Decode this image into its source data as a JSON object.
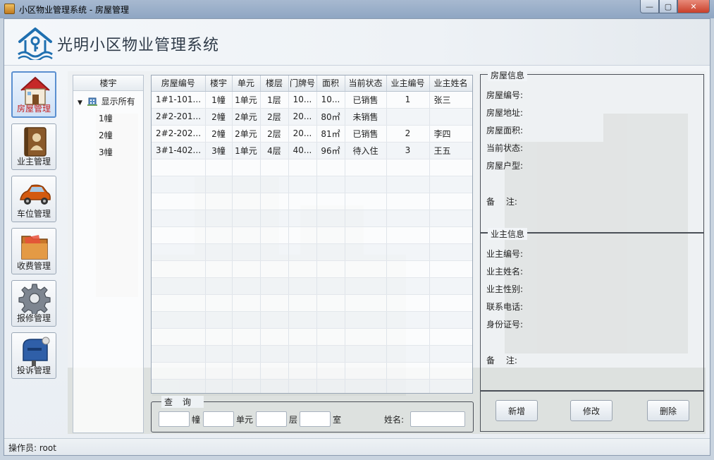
{
  "window": {
    "title": "小区物业管理系统 - 房屋管理",
    "min_label": "—",
    "max_label": "▢",
    "close_label": "✕"
  },
  "header": {
    "app_title": "光明小区物业管理系统"
  },
  "nav": {
    "items": [
      {
        "label": "房屋管理",
        "icon": "house-icon",
        "active": true
      },
      {
        "label": "业主管理",
        "icon": "address-book-icon",
        "active": false
      },
      {
        "label": "车位管理",
        "icon": "car-icon",
        "active": false
      },
      {
        "label": "收费管理",
        "icon": "folder-icon",
        "active": false
      },
      {
        "label": "报修管理",
        "icon": "gear-icon",
        "active": false
      },
      {
        "label": "投诉管理",
        "icon": "mailbox-icon",
        "active": false
      }
    ]
  },
  "tree": {
    "header": "楼宇",
    "root": "显示所有",
    "children": [
      "1幢",
      "2幢",
      "3幢"
    ]
  },
  "table": {
    "columns": [
      "房屋编号",
      "楼宇",
      "单元",
      "楼层",
      "门牌号",
      "面积",
      "当前状态",
      "业主编号",
      "业主姓名"
    ],
    "rows": [
      [
        "1#1-101...",
        "1幢",
        "1单元",
        "1层",
        "10...",
        "10...",
        "已销售",
        "1",
        "张三"
      ],
      [
        "2#2-201...",
        "2幢",
        "2单元",
        "2层",
        "20...",
        "80㎡",
        "未销售",
        "",
        ""
      ],
      [
        "2#2-202...",
        "2幢",
        "2单元",
        "2层",
        "20...",
        "81㎡",
        "已销售",
        "2",
        "李四"
      ],
      [
        "3#1-402...",
        "3幢",
        "1单元",
        "4层",
        "40...",
        "96㎡",
        "待入住",
        "3",
        "王五"
      ]
    ]
  },
  "query": {
    "legend": "查询",
    "unit_building": "幢",
    "unit_unit": "单元",
    "unit_floor": "层",
    "unit_room": "室",
    "name_label": "姓名:"
  },
  "house_info": {
    "legend": "房屋信息",
    "fields": [
      "房屋编号:",
      "房屋地址:",
      "房屋面积:",
      "当前状态:",
      "房屋户型:"
    ],
    "remark": "备　 注:"
  },
  "owner_info": {
    "legend": "业主信息",
    "fields": [
      "业主编号:",
      "业主姓名:",
      "业主性别:",
      "联系电话:",
      "身份证号:"
    ],
    "remark": "备　 注:"
  },
  "buttons": {
    "add": "新增",
    "edit": "修改",
    "delete": "删除"
  },
  "status": {
    "operator": "操作员: root"
  }
}
